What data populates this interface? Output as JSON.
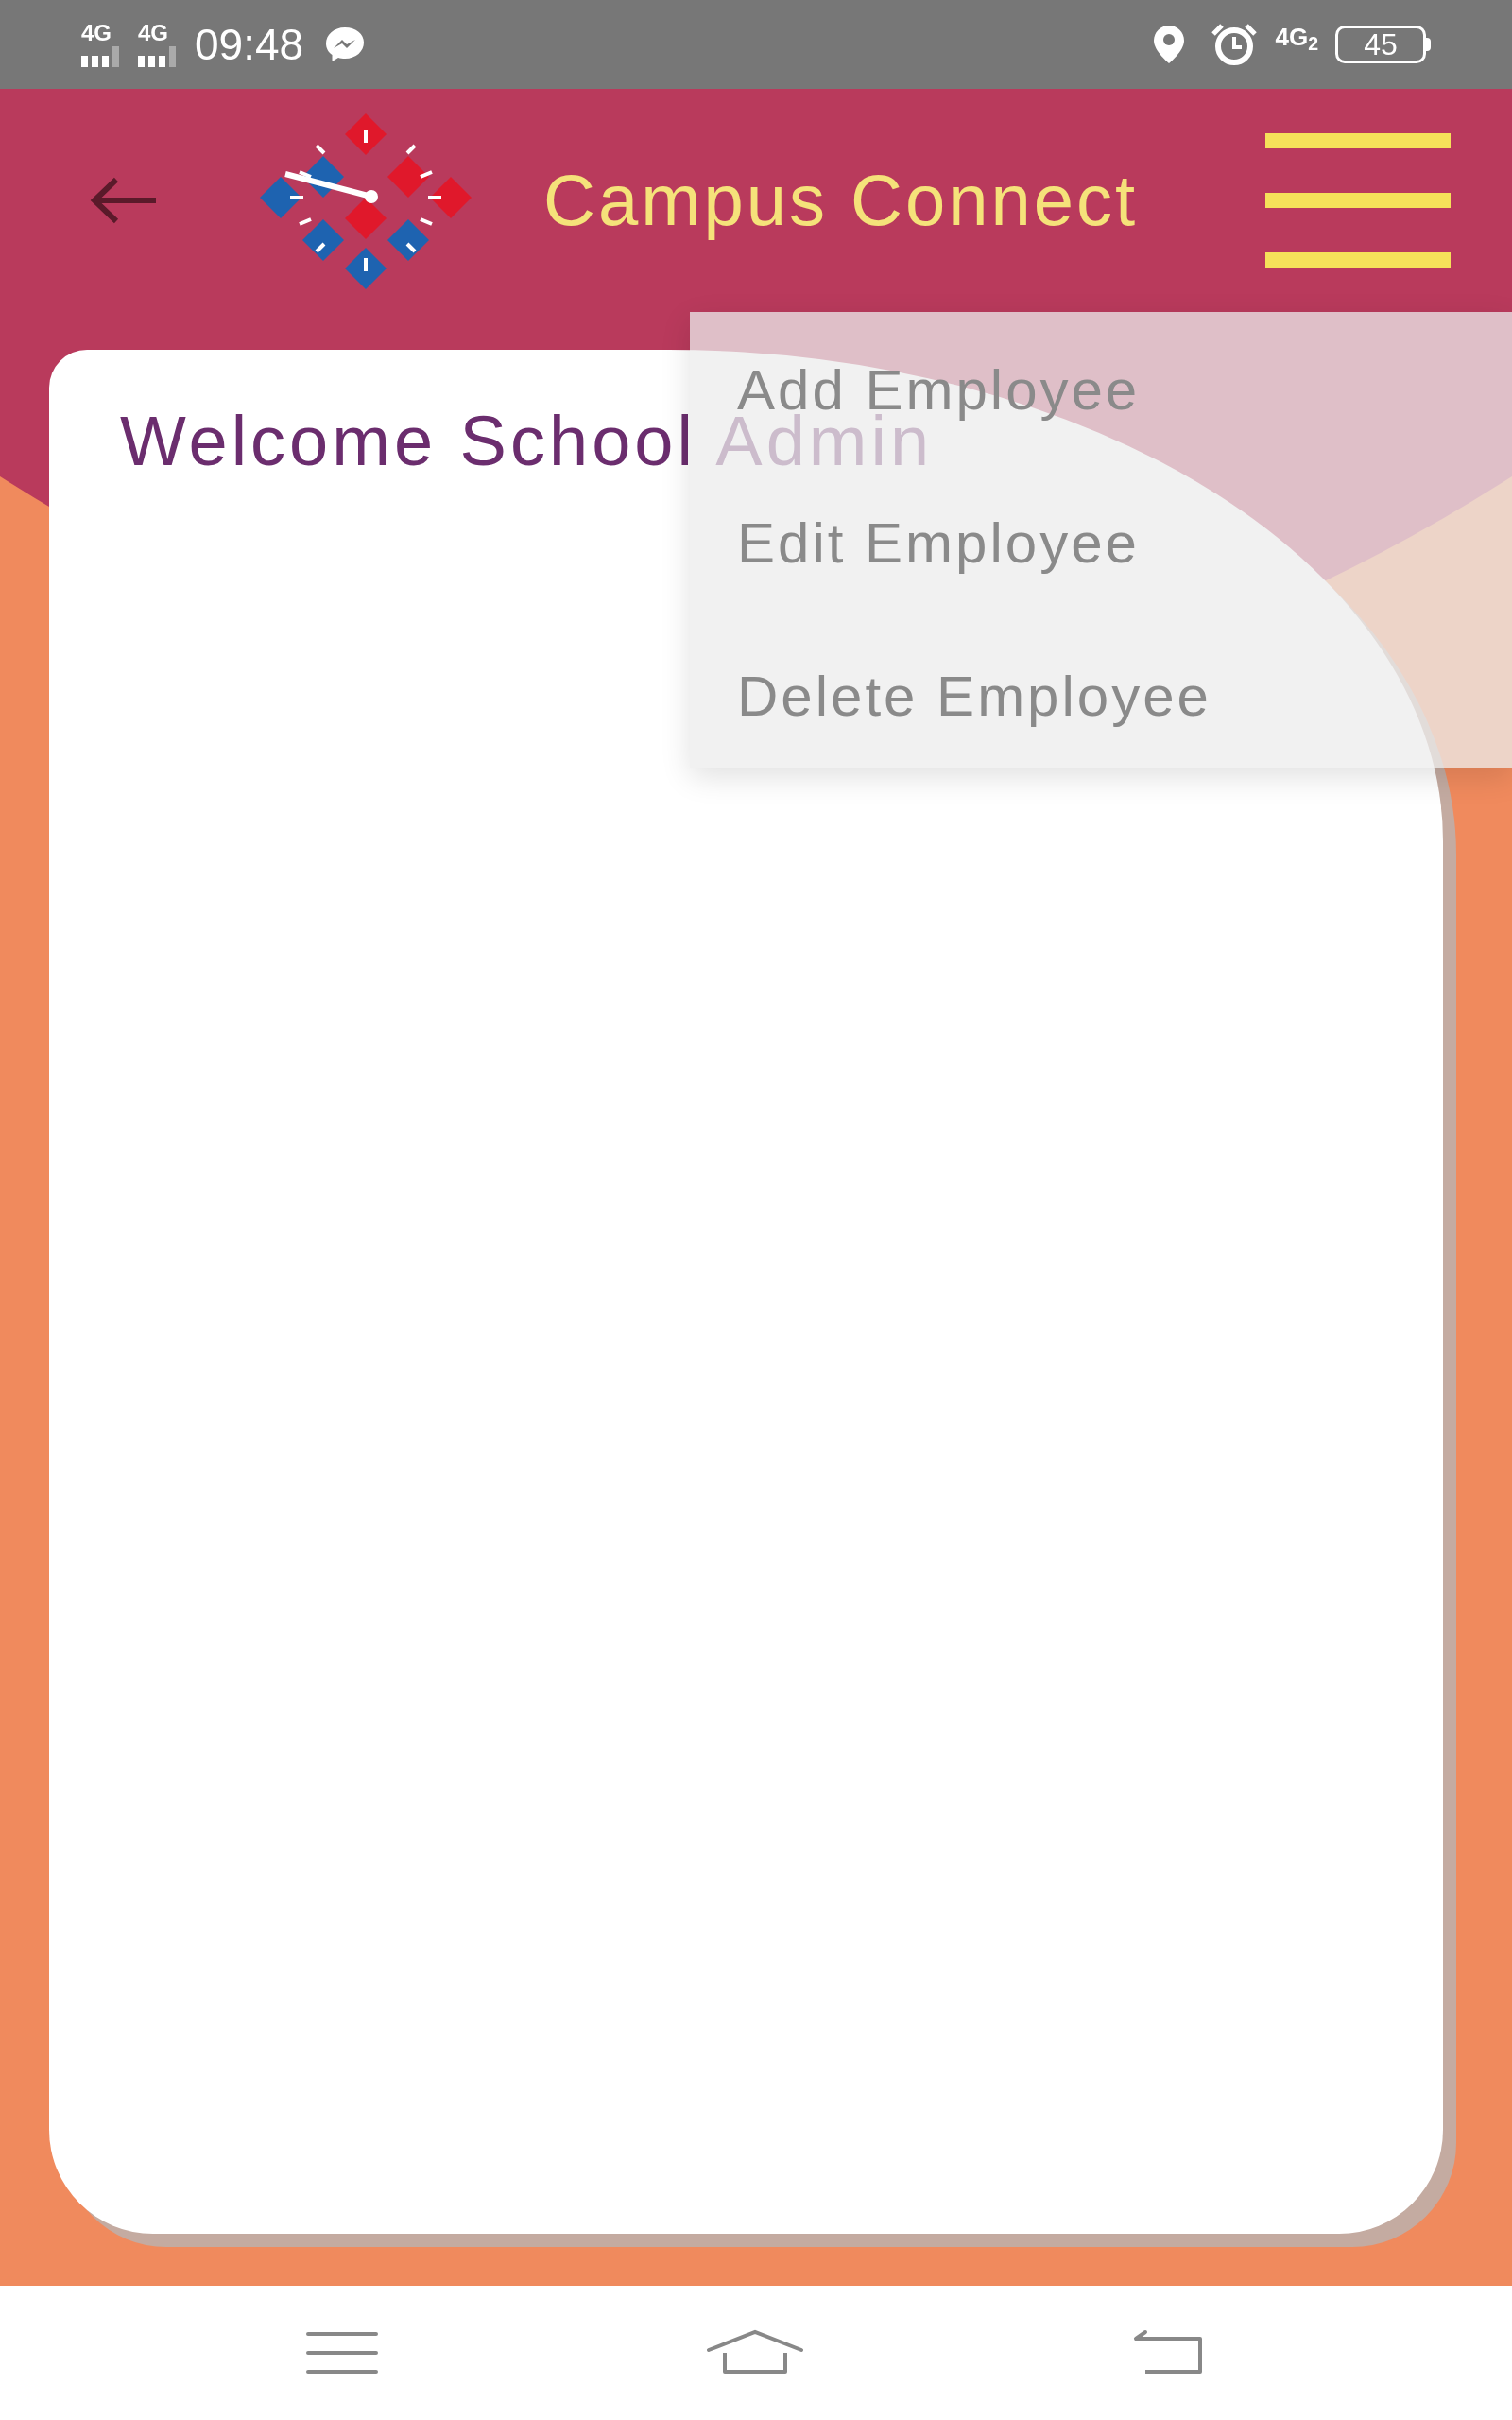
{
  "status_bar": {
    "signals": [
      "4G",
      "4G"
    ],
    "time": "09:48",
    "network": "4G$_{2}$",
    "battery": "45"
  },
  "header": {
    "title": "Campus Connect"
  },
  "welcome": "Welcome School Admin",
  "menu": {
    "items": [
      {
        "label": "Add Employee"
      },
      {
        "label": "Edit Employee"
      },
      {
        "label": "Delete Employee"
      }
    ]
  }
}
